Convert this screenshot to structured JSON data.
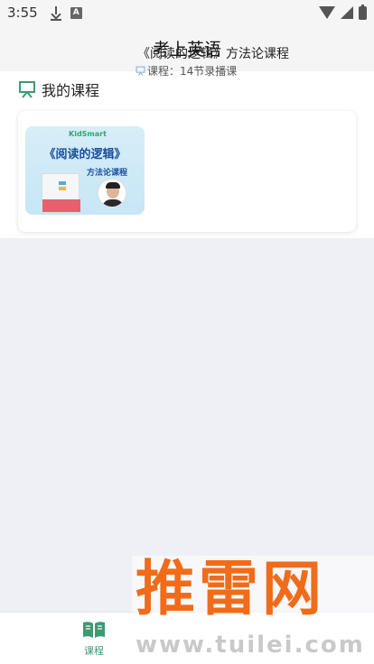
{
  "status_bar": {
    "time": "3:55",
    "icons": [
      "download-icon",
      "a-badge-icon",
      "wifi-icon",
      "signal-icon",
      "battery-icon"
    ],
    "badge_letter": "A"
  },
  "header": {
    "title": "考上英语"
  },
  "section": {
    "title": "我的课程",
    "icon": "board-icon"
  },
  "course": {
    "name": "《阅读的逻辑》方法论课程",
    "meta": "课程：14节录播课",
    "thumbnail": {
      "logo_text": "KidSmart",
      "title": "《阅读的逻辑》",
      "subtitle": "方法论课程"
    }
  },
  "tabbar": {
    "tabs": [
      {
        "label": "课程",
        "icon": "book-icon",
        "active": true
      }
    ]
  },
  "watermark": {
    "main": "推雷网",
    "url": "www.tuilei.com"
  },
  "colors": {
    "accent": "#3d9a73",
    "background": "#eff0f5",
    "watermark": "#f06c1a"
  }
}
